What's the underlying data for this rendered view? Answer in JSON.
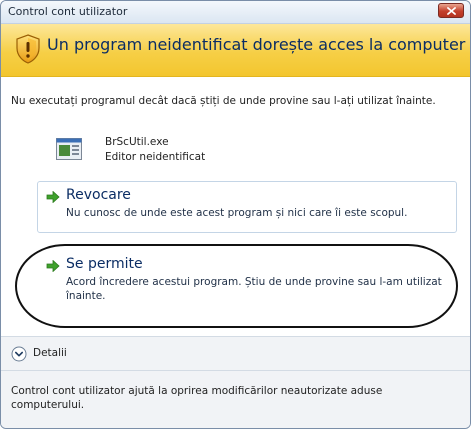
{
  "window": {
    "title": "Control cont utilizator"
  },
  "header": {
    "message": "Un program neidentificat dorește acces la computer",
    "icon": "uac-shield-warning-icon",
    "color": "#f6cf46"
  },
  "main": {
    "instruction": "Nu executați programul decât dacă știți de unde provine sau l-ați utilizat înainte.",
    "program": {
      "file_name": "BrScUtil.exe",
      "publisher": "Editor neidentificat",
      "icon": "application-icon"
    },
    "options": [
      {
        "title": "Revocare",
        "description": "Nu cunosc de unde este acest program și nici care îi este scopul.",
        "icon": "green-arrow-icon"
      },
      {
        "title": "Se permite",
        "description": "Acord încredere acestui program. Știu de unde provine sau l-am utilizat înainte.",
        "icon": "green-arrow-icon"
      }
    ]
  },
  "details": {
    "label": "Detalii",
    "icon": "chevron-down-icon"
  },
  "footer": {
    "text": "Control cont utilizator ajută la oprirea modificărilor neautorizate aduse computerului."
  },
  "colors": {
    "accent_text": "#0b2d64",
    "close_button": "#c4402c",
    "arrow_green": "#3fa12c"
  }
}
